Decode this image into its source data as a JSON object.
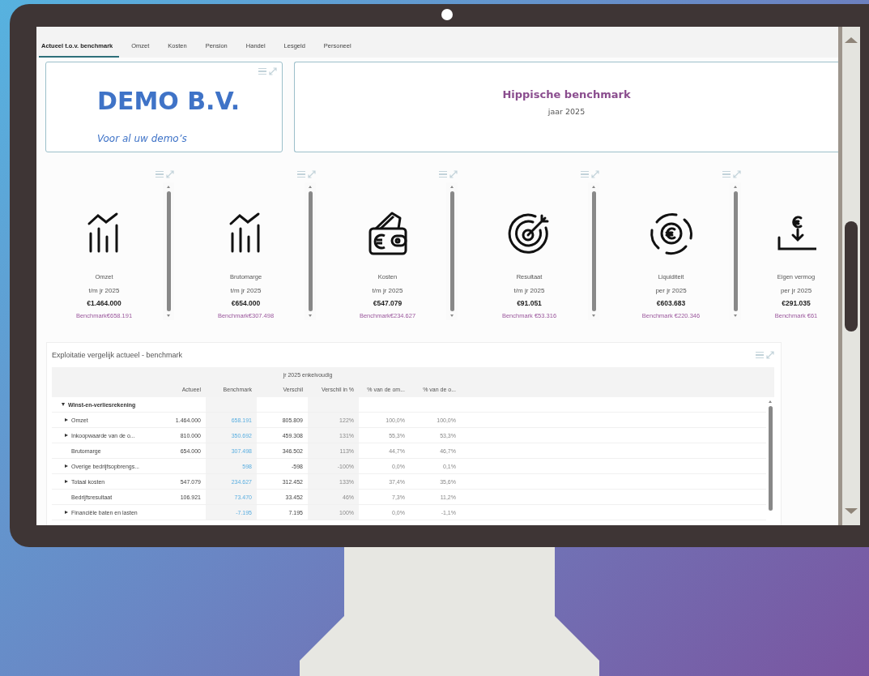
{
  "tabs": [
    {
      "label": "Actueel t.o.v. benchmark",
      "selected": true
    },
    {
      "label": "Omzet",
      "selected": false
    },
    {
      "label": "Kosten",
      "selected": false
    },
    {
      "label": "Pension",
      "selected": false
    },
    {
      "label": "Handel",
      "selected": false
    },
    {
      "label": "Lesgeld",
      "selected": false
    },
    {
      "label": "Personeel",
      "selected": false
    }
  ],
  "logo_card": {
    "title": "DEMO B.V.",
    "tagline": "Voor al uw demo’s"
  },
  "title_card": {
    "title": "Hippische benchmark",
    "subtitle": "jaar 2025"
  },
  "kpis": [
    {
      "kind": "chart",
      "label": "Omzet",
      "period": "t/m jr 2025",
      "value": "€1.464.000",
      "benchmark": "Benchmark€658.191"
    },
    {
      "kind": "chart",
      "label": "Brutomarge",
      "period": "t/m jr 2025",
      "value": "€654.000",
      "benchmark": "Benchmark€307.498"
    },
    {
      "kind": "wallet",
      "label": "Kosten",
      "period": "t/m jr 2025",
      "value": "€547.079",
      "benchmark": "Benchmark€234.627"
    },
    {
      "kind": "target",
      "label": "Resultaat",
      "period": "t/m jr 2025",
      "value": "€91.051",
      "benchmark": "Benchmark €53.316"
    },
    {
      "kind": "cycle",
      "label": "Liquiditeit",
      "period": "per jr 2025",
      "value": "€603.683",
      "benchmark": "Benchmark €220.346"
    },
    {
      "kind": "deposit",
      "label": "Eigen vermog",
      "period": "per jr 2025",
      "value": "€291.035",
      "benchmark": "Benchmark €61"
    }
  ],
  "table": {
    "title": "Exploitatie vergelijk actueel - benchmark",
    "group_header": "jr 2025 enkelvoudig",
    "columns": [
      "Actueel",
      "Benchmark",
      "Verschil",
      "Verschil in %",
      "% van de om...",
      "% van de o..."
    ],
    "rows": [
      {
        "label": "Winst-en-verliesrekening",
        "expanded": true,
        "children": [
          {
            "kind": "group",
            "expanded": false,
            "label": "Omzet",
            "actual": "1.464.000",
            "values": [
              "658.191",
              "805.809",
              "122%",
              "100,0%",
              "100,0%"
            ]
          },
          {
            "kind": "group",
            "expanded": false,
            "label": "Inkoopwaarde van de o...",
            "actual": "810.000",
            "values": [
              "350.692",
              "459.308",
              "131%",
              "55,3%",
              "53,3%"
            ]
          },
          {
            "kind": "line",
            "label": "Brutomarge",
            "actual": "654.000",
            "values": [
              "307.498",
              "346.502",
              "113%",
              "44,7%",
              "46,7%"
            ]
          },
          {
            "kind": "group",
            "expanded": false,
            "label": "Overige bedrijfsopbrengs...",
            "values": [
              "598",
              "-598",
              "-100%",
              "0,0%",
              "0,1%"
            ]
          },
          {
            "kind": "group",
            "expanded": false,
            "label": "Totaal kosten",
            "actual": "547.079",
            "values": [
              "234.627",
              "312.452",
              "133%",
              "37,4%",
              "35,6%"
            ]
          },
          {
            "kind": "line",
            "label": "Bedrijfsresultaat",
            "actual": "106.921",
            "values": [
              "73.470",
              "33.452",
              "46%",
              "7,3%",
              "11,2%"
            ]
          },
          {
            "kind": "group",
            "expanded": false,
            "label": "Financiële baten en lasten",
            "values": [
              "-7.195",
              "7.195",
              "100%",
              "0,0%",
              "-1,1%"
            ]
          }
        ]
      }
    ]
  }
}
